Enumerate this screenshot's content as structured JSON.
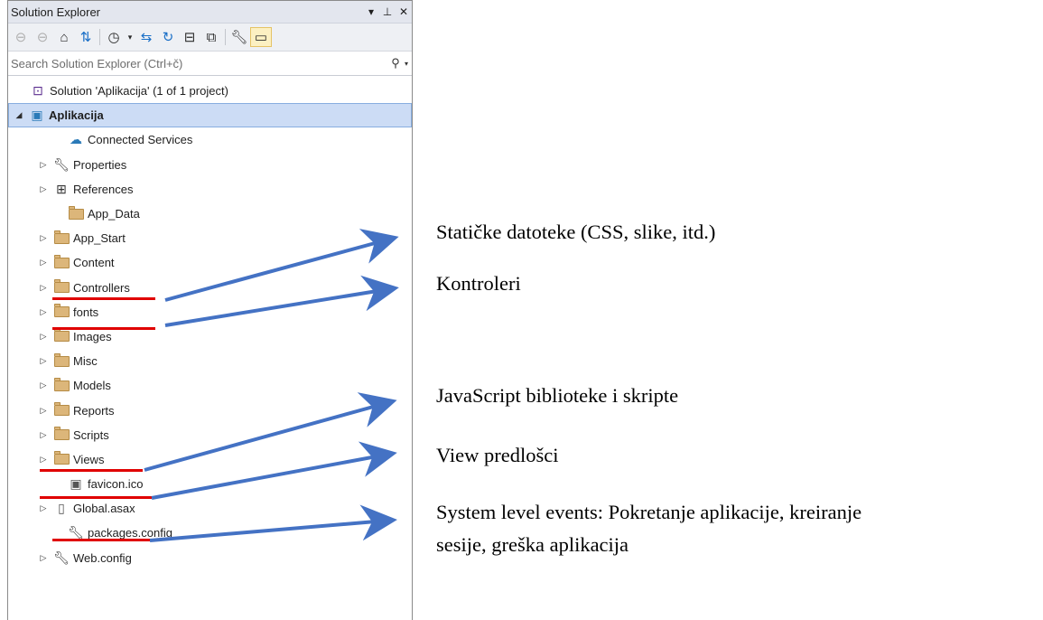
{
  "panel": {
    "title": "Solution Explorer",
    "title_buttons": [
      "▾",
      "⊥",
      "✕"
    ],
    "search_placeholder": "Search Solution Explorer (Ctrl+č)",
    "toolbar_icons": [
      "back-icon",
      "forward-icon",
      "home-icon",
      "switch-views-icon",
      "pending-changes-icon",
      "dropdown-icon",
      "sync-icon",
      "refresh-icon",
      "collapse-all-icon",
      "show-all-files-icon",
      "properties-icon",
      "preview-icon"
    ]
  },
  "tree": [
    {
      "label": "Solution 'Aplikacija' (1 of 1 project)",
      "icon": "solution-icon",
      "expander": ""
    },
    {
      "label": "Aplikacija",
      "icon": "project-icon",
      "expander": "◢",
      "selected": true
    },
    {
      "label": "Connected Services",
      "icon": "connected-services-icon",
      "expander": ""
    },
    {
      "label": "Properties",
      "icon": "wrench-icon",
      "expander": "▷"
    },
    {
      "label": "References",
      "icon": "references-icon",
      "expander": "▷"
    },
    {
      "label": "App_Data",
      "icon": "folder-icon",
      "expander": ""
    },
    {
      "label": "App_Start",
      "icon": "folder-icon",
      "expander": "▷"
    },
    {
      "label": "Content",
      "icon": "folder-icon",
      "expander": "▷"
    },
    {
      "label": "Controllers",
      "icon": "folder-icon",
      "expander": "▷"
    },
    {
      "label": "fonts",
      "icon": "folder-icon",
      "expander": "▷"
    },
    {
      "label": "Images",
      "icon": "folder-icon",
      "expander": "▷"
    },
    {
      "label": "Misc",
      "icon": "folder-icon",
      "expander": "▷"
    },
    {
      "label": "Models",
      "icon": "folder-icon",
      "expander": "▷"
    },
    {
      "label": "Reports",
      "icon": "folder-icon",
      "expander": "▷"
    },
    {
      "label": "Scripts",
      "icon": "folder-icon",
      "expander": "▷"
    },
    {
      "label": "Views",
      "icon": "folder-icon",
      "expander": "▷"
    },
    {
      "label": "favicon.ico",
      "icon": "image-file-icon",
      "expander": ""
    },
    {
      "label": "Global.asax",
      "icon": "file-icon",
      "expander": "▷"
    },
    {
      "label": "packages.config",
      "icon": "config-file-icon",
      "expander": ""
    },
    {
      "label": "Web.config",
      "icon": "config-file-icon",
      "expander": "▷"
    }
  ],
  "annotations": {
    "content": "Statičke datoteke (CSS, slike, itd.)",
    "controllers": "Kontroleri",
    "scripts": "JavaScript biblioteke i skripte",
    "views": "View predlošci",
    "global_line1": "System level events: Pokretanje aplikacije, kreiranje",
    "global_line2": "sesije, greška aplikacija"
  },
  "colors": {
    "arrow": "#4472c4",
    "underline": "#e00000",
    "selection": "#ccdcf5",
    "folder": "#dcb67a"
  }
}
